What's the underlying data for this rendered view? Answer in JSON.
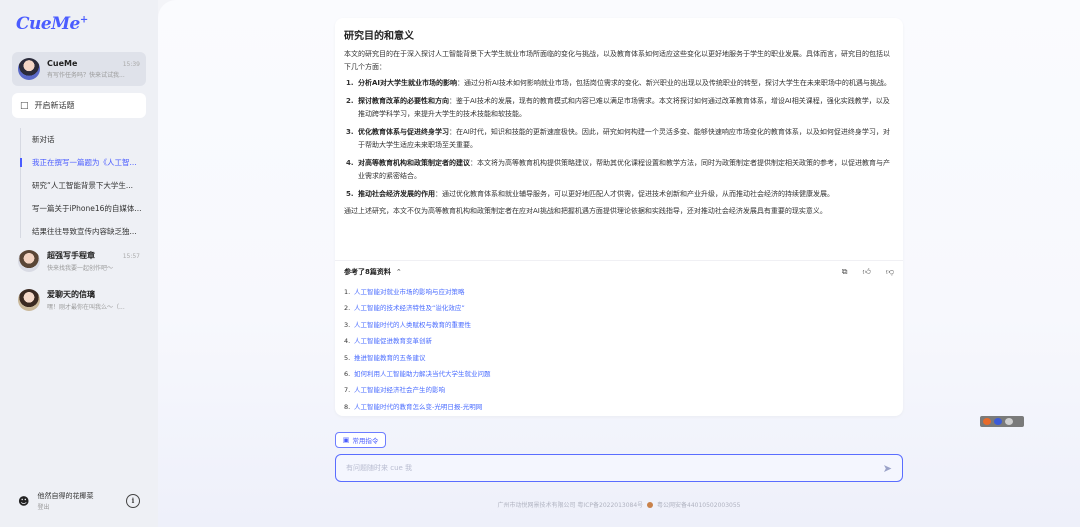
{
  "app": {
    "logo": "CueMe",
    "logo_sup": "+"
  },
  "sidebar": {
    "agents": [
      {
        "name": "CueMe",
        "time": "15:39",
        "desc": "有写作任务吗？快来试试我...",
        "active": true
      },
      {
        "name": "超强写手程章",
        "time": "15:57",
        "desc": "快来找我要一起创作吧～",
        "active": false
      },
      {
        "name": "爱聊天的信璃",
        "time": "",
        "desc": "嘿！刚才最你在叫我么～（...",
        "active": false
      }
    ],
    "new_topic_label": "开启新话题",
    "topics": [
      {
        "label": "新对话",
        "active": false
      },
      {
        "label": "我正在撰写一篇题为《人工智...",
        "active": true
      },
      {
        "label": "研究“人工智能背景下大学生...",
        "active": false
      },
      {
        "label": "写一篇关于iPhone16的自媒体...",
        "active": false
      },
      {
        "label": "结果往往导致宣传内容缺乏独...",
        "active": false
      }
    ],
    "user": {
      "name": "他然自得的花椰菜",
      "logout": "登出"
    }
  },
  "card": {
    "title": "研究目的和意义",
    "intro": "本文的研究目的在于深入探讨人工智能背景下大学生就业市场所面临的变化与挑战，以及教育体系如何适应这些变化以更好地服务于学生的职业发展。具体而言，研究目的包括以下几个方面：",
    "points": [
      {
        "num": "1.",
        "bold": "分析AI对大学生就业市场的影响",
        "text": "：通过分析AI技术如何影响就业市场，包括岗位需求的变化、新兴职业的出现以及传统职业的转型，探讨大学生在未来职场中的机遇与挑战。"
      },
      {
        "num": "2.",
        "bold": "探讨教育改革的必要性和方向",
        "text": "：鉴于AI技术的发展，现有的教育模式和内容已难以满足市场需求。本文将探讨如何通过改革教育体系，增设AI相关课程，强化实践教学，以及推动跨学科学习，来提升大学生的技术技能和软技能。"
      },
      {
        "num": "3.",
        "bold": "优化教育体系与促进终身学习",
        "text": "：在AI时代，知识和技能的更新速度极快。因此，研究如何构建一个灵活多变、能够快速响应市场变化的教育体系，以及如何促进终身学习，对于帮助大学生适应未来职场至关重要。"
      },
      {
        "num": "4.",
        "bold": "对高等教育机构和政策制定者的建议",
        "text": "：本文将为高等教育机构提供策略建议，帮助其优化课程设置和教学方法，同时为政策制定者提供制定相关政策的参考，以促进教育与产业需求的紧密结合。"
      },
      {
        "num": "5.",
        "bold": "推动社会经济发展的作用",
        "text": "：通过优化教育体系和就业辅导服务，可以更好地匹配人才供需，促进技术创新和产业升级，从而推动社会经济的持续健康发展。"
      }
    ],
    "conclusion": "通过上述研究，本文不仅为高等教育机构和政策制定者在应对AI挑战和把握机遇方面提供理论依据和实践指导，还对推动社会经济发展具有重要的现实意义。",
    "refs_title": "参考了8篇资料",
    "refs": [
      {
        "num": "1.",
        "title": "人工智能对就业市场的影响与应对策略"
      },
      {
        "num": "2.",
        "title": "人工智能的技术经济特性及“溢化效应”"
      },
      {
        "num": "3.",
        "title": "人工智能时代的人类赋权与教育的重要性"
      },
      {
        "num": "4.",
        "title": "人工智能促进教育变革创新"
      },
      {
        "num": "5.",
        "title": "推进智能教育的五条建议"
      },
      {
        "num": "6.",
        "title": "如何利用人工智能助力解决当代大学生就业问题"
      },
      {
        "num": "7.",
        "title": "人工智能对经济社会产生的影响"
      },
      {
        "num": "8.",
        "title": "人工智能时代的教育怎么变-光明日报-光明网"
      }
    ]
  },
  "composer": {
    "command_label": "常用指令",
    "placeholder": "有问题随时来 cue 我",
    "footer": "广州市动悦网景技术有限公司 粤ICP备2022013084号",
    "footer_badge": "粤公网安备44010502003055"
  },
  "icons": {
    "new_topic": "chat-plus-icon",
    "copy": "copy-icon",
    "like": "thumbs-up-icon",
    "dislike": "thumbs-down-icon",
    "send": "send-icon",
    "info": "info-icon",
    "user": "user-icon",
    "command": "command-icon"
  },
  "colors": {
    "accent": "#4a5cff",
    "link": "#4a6cff"
  }
}
